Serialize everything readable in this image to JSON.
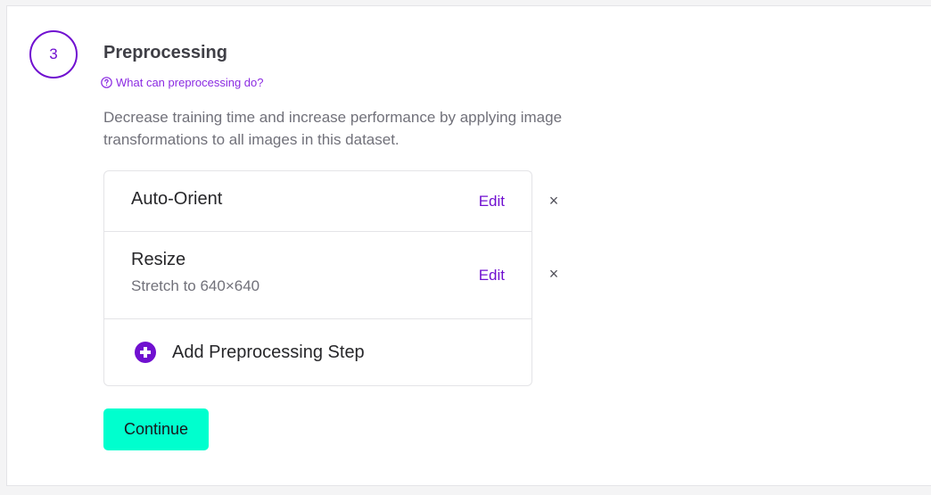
{
  "step": {
    "number": "3",
    "title": "Preprocessing",
    "help_link": "What can preprocessing do?",
    "description": "Decrease training time and increase performance by applying image transformations to all images in this dataset."
  },
  "preprocessing_steps": [
    {
      "name": "Auto-Orient",
      "detail": "",
      "edit_label": "Edit",
      "remove_label": "×"
    },
    {
      "name": "Resize",
      "detail": "Stretch to 640×640",
      "edit_label": "Edit",
      "remove_label": "×"
    }
  ],
  "add_step_label": "Add Preprocessing Step",
  "continue_label": "Continue",
  "icons": {
    "help": "question-circle-icon",
    "add": "plus-circle-icon",
    "remove": "close-icon"
  },
  "colors": {
    "accent": "#7010d0",
    "link": "#8b2be2",
    "button": "#00ffce"
  }
}
